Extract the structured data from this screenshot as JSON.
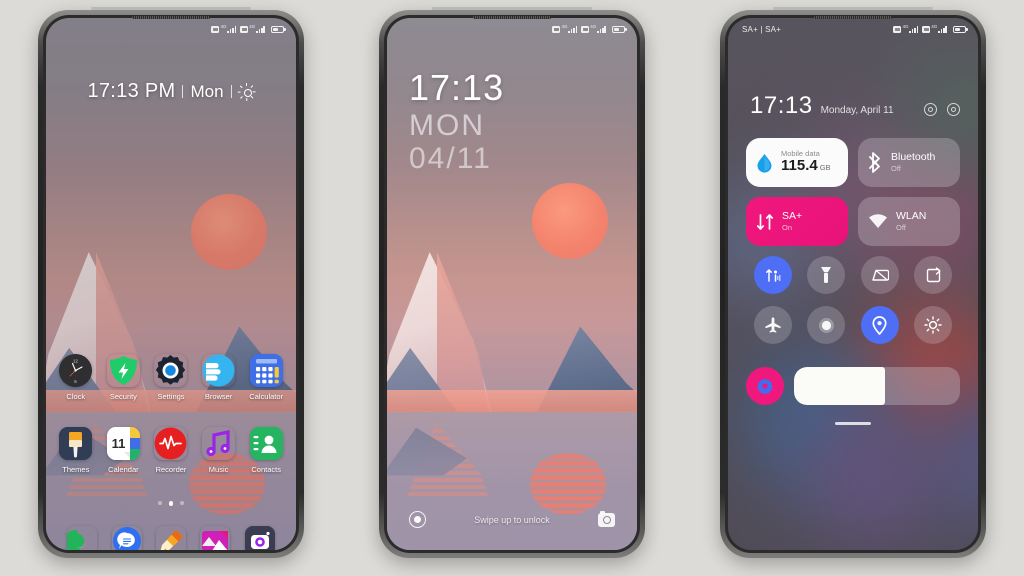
{
  "scene": {
    "background_color": "#dcdbd7",
    "phone_count": 3
  },
  "phone_home": {
    "name": "home-screen",
    "status_bar": {
      "carrier_text": "",
      "network_label": "4G",
      "battery": ""
    },
    "clock_widget": {
      "time": "17:13 PM",
      "day": "Mon",
      "weather_icon": "sun-icon"
    },
    "app_rows": [
      [
        {
          "label": "Clock",
          "icon": "clock-icon"
        },
        {
          "label": "Security",
          "icon": "shield-icon"
        },
        {
          "label": "Settings",
          "icon": "gear-icon"
        },
        {
          "label": "Browser",
          "icon": "browser-icon"
        },
        {
          "label": "Calculator",
          "icon": "calculator-icon"
        }
      ],
      [
        {
          "label": "Themes",
          "icon": "brush-icon"
        },
        {
          "label": "Calendar",
          "icon": "calendar-icon",
          "day_number": "11"
        },
        {
          "label": "Recorder",
          "icon": "waveform-icon"
        },
        {
          "label": "Music",
          "icon": "music-note-icon"
        },
        {
          "label": "Contacts",
          "icon": "contact-card-icon"
        }
      ]
    ],
    "page_dots": {
      "count": 3,
      "active_index": 1
    },
    "dock": [
      {
        "label": "Phone",
        "icon": "phone-icon"
      },
      {
        "label": "Messages",
        "icon": "message-icon"
      },
      {
        "label": "Notes",
        "icon": "pencil-icon"
      },
      {
        "label": "Gallery",
        "icon": "gallery-icon"
      },
      {
        "label": "Camera",
        "icon": "camera-icon"
      }
    ]
  },
  "phone_lock": {
    "name": "lock-screen",
    "clock": {
      "time": "17:13",
      "day_of_week": "MON",
      "date": "04/11"
    },
    "unlock_hint": "Swipe up to unlock",
    "left_shortcut_icon": "record-circle-icon",
    "right_shortcut_icon": "camera-icon"
  },
  "phone_control_center": {
    "name": "control-center",
    "status_bar": {
      "carrier_text": "SA+ | SA+",
      "network_label": "4G"
    },
    "header": {
      "time": "17:13",
      "date": "Monday, April 11",
      "icons": [
        "target-icon",
        "target-icon"
      ]
    },
    "big_tiles": [
      {
        "id": "mobile-data",
        "title": "Mobile data",
        "value": "115.4",
        "unit": "GB",
        "state": "on",
        "style": "white",
        "icon": "water-drop-icon",
        "accent": "#18a0e8"
      },
      {
        "id": "bluetooth",
        "title": "Bluetooth",
        "state_label": "Off",
        "style": "glass",
        "icon": "bluetooth-icon"
      },
      {
        "id": "sa-plus",
        "title": "SA+",
        "state_label": "On",
        "style": "pink",
        "icon": "data-transfer-icon",
        "accent": "#f0187c"
      },
      {
        "id": "wlan",
        "title": "WLAN",
        "state_label": "Off",
        "style": "glass",
        "icon": "wifi-icon"
      }
    ],
    "toggles": [
      {
        "id": "sound",
        "icon": "sound-vibrate-icon",
        "active": true
      },
      {
        "id": "flashlight",
        "icon": "flashlight-icon",
        "active": false
      },
      {
        "id": "screenshot",
        "icon": "screenshot-icon",
        "active": false
      },
      {
        "id": "auto-rotate",
        "icon": "auto-rotate-icon",
        "active": false
      },
      {
        "id": "airplane",
        "icon": "airplane-icon",
        "active": false
      },
      {
        "id": "screen-record",
        "icon": "record-dot-icon",
        "active": false
      },
      {
        "id": "location",
        "icon": "location-pin-icon",
        "active": true
      },
      {
        "id": "auto-brightness",
        "icon": "brightness-icon",
        "active": false
      }
    ],
    "settings_button": {
      "icon": "settings-flower-icon",
      "accent": "#f0187c"
    },
    "brightness_slider": {
      "value_percent": 55,
      "icon": "brightness-slider"
    },
    "home_indicator": true
  }
}
